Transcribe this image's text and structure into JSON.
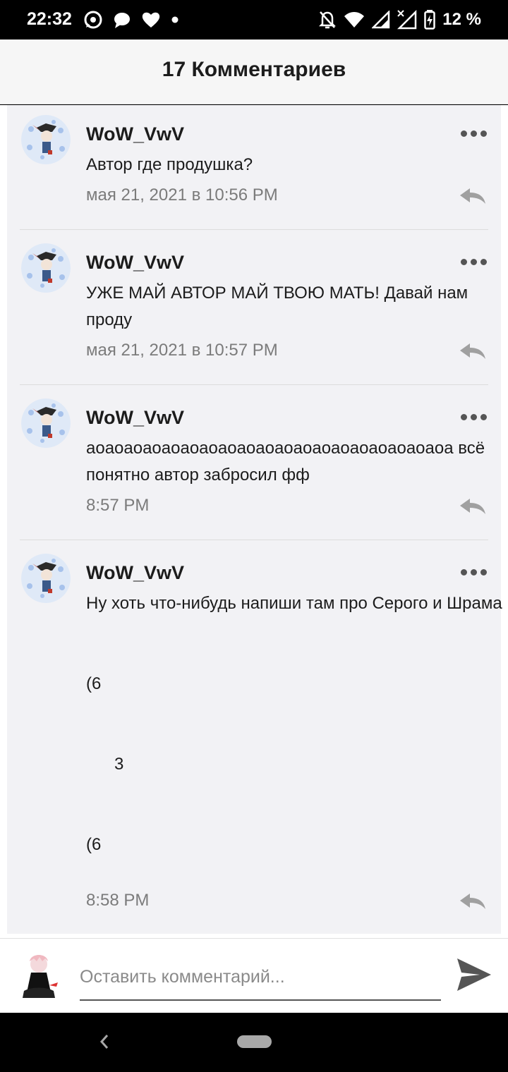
{
  "status_bar": {
    "time": "22:32",
    "battery_percent": "12 %",
    "icons": [
      "whatsapp-icon",
      "message-icon",
      "heart-icon",
      "dot-icon",
      "notifications-off-icon",
      "wifi-icon",
      "signal-icon",
      "signal-no-data-icon",
      "battery-charging-icon"
    ]
  },
  "header": {
    "title": "17 Комментариев"
  },
  "comments": [
    {
      "author": "WoW_VwV",
      "text": "Автор где продушка?",
      "date": "мая 21, 2021 в 10:56 PM"
    },
    {
      "author": "WoW_VwV",
      "text": "УЖЕ МАЙ АВТОР МАЙ ТВОЮ МАТЬ! Давай нам проду",
      "date": "мая 21, 2021 в 10:57 PM"
    },
    {
      "author": "WoW_VwV",
      "text": "аоаоаоаоаоаоаоаоаоаоаоаоаоаоаоаоаоаоаоа всё понятно автор забросил фф",
      "date": "8:57 PM"
    },
    {
      "author": "WoW_VwV",
      "text": "Ну хоть что-нибудь напиши там про Серого и Шрама\n\n\n(6\n\n\n      3\n\n\n(6",
      "date": "8:58 PM"
    }
  ],
  "composer": {
    "placeholder": "Оставить комментарий..."
  },
  "colors": {
    "accent": "#555555",
    "background": "#f2f2f5",
    "date_text": "#7b7b7b"
  }
}
